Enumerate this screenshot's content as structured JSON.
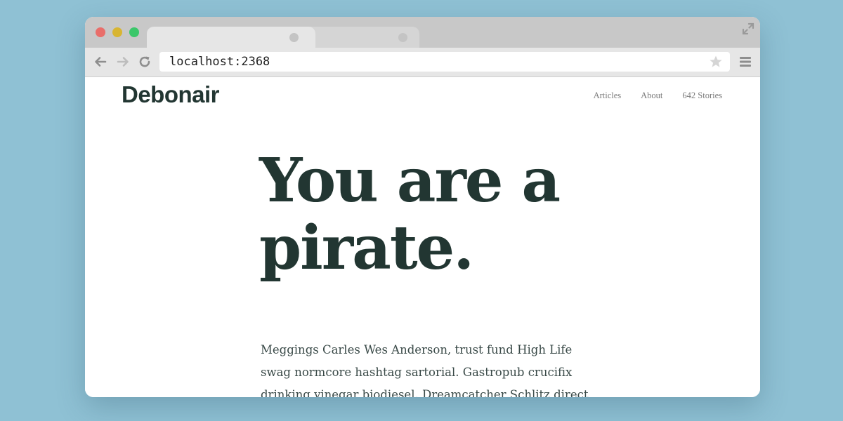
{
  "browser": {
    "address": "localhost:2368",
    "colors": {
      "close": "#e96e6a",
      "minimize": "#d8b532",
      "maximize": "#3bc76a"
    },
    "icons": [
      "back-arrow-icon",
      "forward-arrow-icon",
      "reload-icon",
      "star-icon",
      "menu-icon",
      "expand-icon"
    ]
  },
  "site": {
    "title": "Debonair",
    "nav": {
      "articles": "Articles",
      "about": "About",
      "stories": "642 Stories"
    }
  },
  "main": {
    "hero_line1": "You are a",
    "hero_line2": "pirate.",
    "body": "Meggings Carles Wes Anderson, trust fund High Life swag normcore hashtag sartorial. Gastropub crucifix drinking vinegar biodiesel. Dreamcatcher Schlitz direct trade"
  },
  "colors": {
    "background": "#8fc1d4",
    "heading": "#223632",
    "nav_text": "#7a7a7a"
  }
}
